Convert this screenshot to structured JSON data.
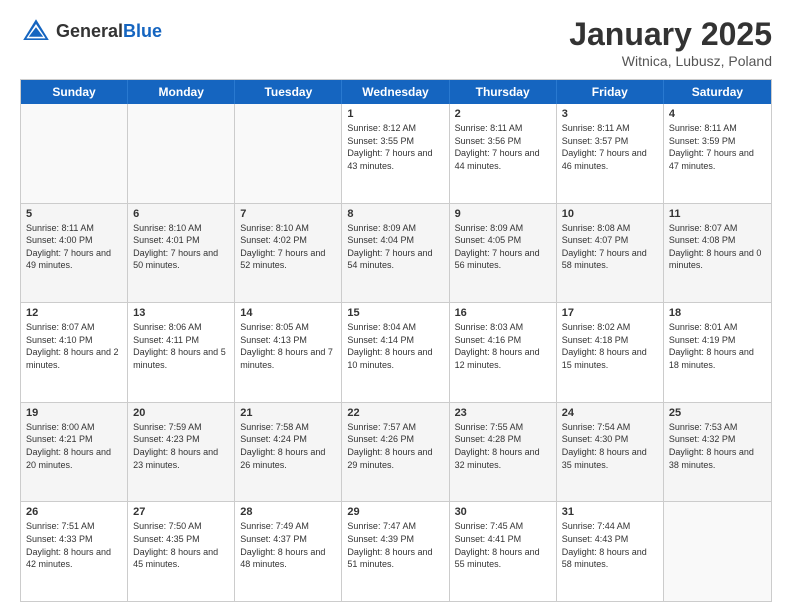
{
  "header": {
    "logo_general": "General",
    "logo_blue": "Blue",
    "title": "January 2025",
    "subtitle": "Witnica, Lubusz, Poland"
  },
  "weekdays": [
    "Sunday",
    "Monday",
    "Tuesday",
    "Wednesday",
    "Thursday",
    "Friday",
    "Saturday"
  ],
  "rows": [
    [
      {
        "day": "",
        "info": ""
      },
      {
        "day": "",
        "info": ""
      },
      {
        "day": "",
        "info": ""
      },
      {
        "day": "1",
        "info": "Sunrise: 8:12 AM\nSunset: 3:55 PM\nDaylight: 7 hours and 43 minutes."
      },
      {
        "day": "2",
        "info": "Sunrise: 8:11 AM\nSunset: 3:56 PM\nDaylight: 7 hours and 44 minutes."
      },
      {
        "day": "3",
        "info": "Sunrise: 8:11 AM\nSunset: 3:57 PM\nDaylight: 7 hours and 46 minutes."
      },
      {
        "day": "4",
        "info": "Sunrise: 8:11 AM\nSunset: 3:59 PM\nDaylight: 7 hours and 47 minutes."
      }
    ],
    [
      {
        "day": "5",
        "info": "Sunrise: 8:11 AM\nSunset: 4:00 PM\nDaylight: 7 hours and 49 minutes."
      },
      {
        "day": "6",
        "info": "Sunrise: 8:10 AM\nSunset: 4:01 PM\nDaylight: 7 hours and 50 minutes."
      },
      {
        "day": "7",
        "info": "Sunrise: 8:10 AM\nSunset: 4:02 PM\nDaylight: 7 hours and 52 minutes."
      },
      {
        "day": "8",
        "info": "Sunrise: 8:09 AM\nSunset: 4:04 PM\nDaylight: 7 hours and 54 minutes."
      },
      {
        "day": "9",
        "info": "Sunrise: 8:09 AM\nSunset: 4:05 PM\nDaylight: 7 hours and 56 minutes."
      },
      {
        "day": "10",
        "info": "Sunrise: 8:08 AM\nSunset: 4:07 PM\nDaylight: 7 hours and 58 minutes."
      },
      {
        "day": "11",
        "info": "Sunrise: 8:07 AM\nSunset: 4:08 PM\nDaylight: 8 hours and 0 minutes."
      }
    ],
    [
      {
        "day": "12",
        "info": "Sunrise: 8:07 AM\nSunset: 4:10 PM\nDaylight: 8 hours and 2 minutes."
      },
      {
        "day": "13",
        "info": "Sunrise: 8:06 AM\nSunset: 4:11 PM\nDaylight: 8 hours and 5 minutes."
      },
      {
        "day": "14",
        "info": "Sunrise: 8:05 AM\nSunset: 4:13 PM\nDaylight: 8 hours and 7 minutes."
      },
      {
        "day": "15",
        "info": "Sunrise: 8:04 AM\nSunset: 4:14 PM\nDaylight: 8 hours and 10 minutes."
      },
      {
        "day": "16",
        "info": "Sunrise: 8:03 AM\nSunset: 4:16 PM\nDaylight: 8 hours and 12 minutes."
      },
      {
        "day": "17",
        "info": "Sunrise: 8:02 AM\nSunset: 4:18 PM\nDaylight: 8 hours and 15 minutes."
      },
      {
        "day": "18",
        "info": "Sunrise: 8:01 AM\nSunset: 4:19 PM\nDaylight: 8 hours and 18 minutes."
      }
    ],
    [
      {
        "day": "19",
        "info": "Sunrise: 8:00 AM\nSunset: 4:21 PM\nDaylight: 8 hours and 20 minutes."
      },
      {
        "day": "20",
        "info": "Sunrise: 7:59 AM\nSunset: 4:23 PM\nDaylight: 8 hours and 23 minutes."
      },
      {
        "day": "21",
        "info": "Sunrise: 7:58 AM\nSunset: 4:24 PM\nDaylight: 8 hours and 26 minutes."
      },
      {
        "day": "22",
        "info": "Sunrise: 7:57 AM\nSunset: 4:26 PM\nDaylight: 8 hours and 29 minutes."
      },
      {
        "day": "23",
        "info": "Sunrise: 7:55 AM\nSunset: 4:28 PM\nDaylight: 8 hours and 32 minutes."
      },
      {
        "day": "24",
        "info": "Sunrise: 7:54 AM\nSunset: 4:30 PM\nDaylight: 8 hours and 35 minutes."
      },
      {
        "day": "25",
        "info": "Sunrise: 7:53 AM\nSunset: 4:32 PM\nDaylight: 8 hours and 38 minutes."
      }
    ],
    [
      {
        "day": "26",
        "info": "Sunrise: 7:51 AM\nSunset: 4:33 PM\nDaylight: 8 hours and 42 minutes."
      },
      {
        "day": "27",
        "info": "Sunrise: 7:50 AM\nSunset: 4:35 PM\nDaylight: 8 hours and 45 minutes."
      },
      {
        "day": "28",
        "info": "Sunrise: 7:49 AM\nSunset: 4:37 PM\nDaylight: 8 hours and 48 minutes."
      },
      {
        "day": "29",
        "info": "Sunrise: 7:47 AM\nSunset: 4:39 PM\nDaylight: 8 hours and 51 minutes."
      },
      {
        "day": "30",
        "info": "Sunrise: 7:45 AM\nSunset: 4:41 PM\nDaylight: 8 hours and 55 minutes."
      },
      {
        "day": "31",
        "info": "Sunrise: 7:44 AM\nSunset: 4:43 PM\nDaylight: 8 hours and 58 minutes."
      },
      {
        "day": "",
        "info": ""
      }
    ]
  ]
}
